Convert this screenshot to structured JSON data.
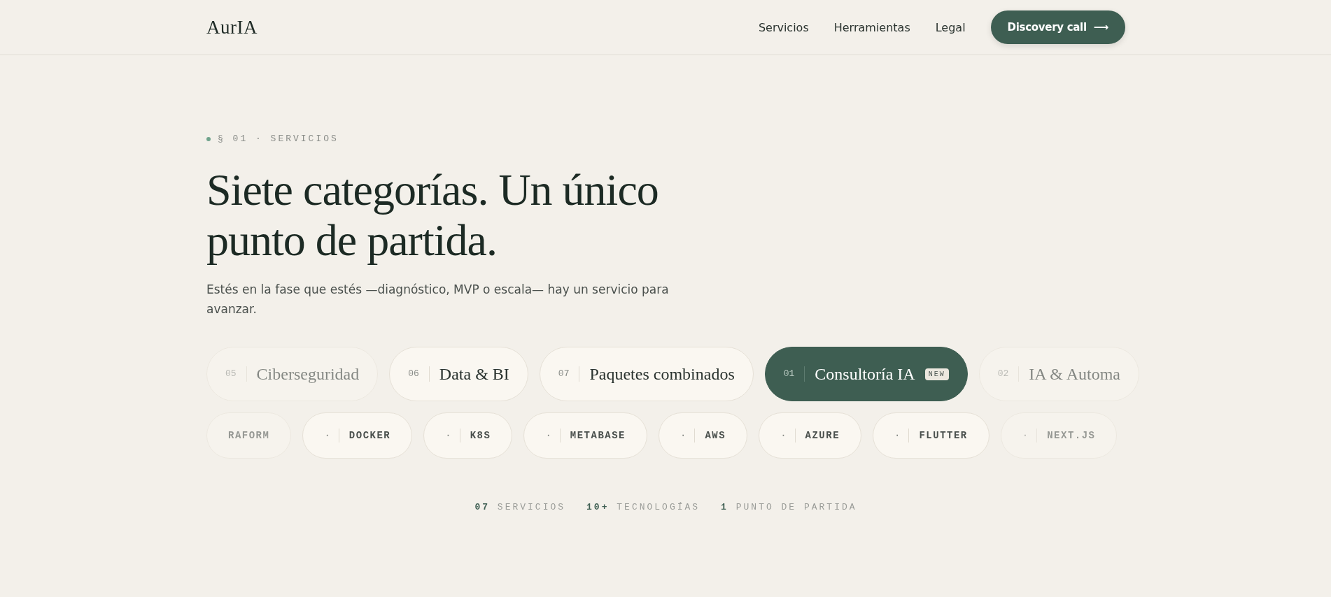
{
  "header": {
    "logo": "AurIA",
    "nav": [
      {
        "label": "Servicios"
      },
      {
        "label": "Herramientas"
      },
      {
        "label": "Legal"
      }
    ],
    "cta": {
      "label": "Discovery call",
      "arrow": "⟶"
    }
  },
  "section": {
    "eyebrow": "§ 01 · SERVICIOS",
    "title": "Siete categorías. Un único punto de partida.",
    "lead": "Estés en la fase que estés —diagnóstico, MVP o escala— hay un servicio para avanzar."
  },
  "services": [
    {
      "number": "05",
      "label": "Ciberseguridad",
      "selected": false,
      "faded": true
    },
    {
      "number": "06",
      "label": "Data & BI",
      "selected": false,
      "faded": false
    },
    {
      "number": "07",
      "label": "Paquetes combinados",
      "selected": false,
      "faded": false
    },
    {
      "number": "01",
      "label": "Consultoría IA",
      "badge": "NEW",
      "selected": true,
      "faded": false
    },
    {
      "number": "02",
      "label": "IA & Automa",
      "selected": false,
      "faded": true
    }
  ],
  "technologies": [
    {
      "label": "RAFORM",
      "faded": true
    },
    {
      "marker": "·",
      "label": "DOCKER",
      "faded": false
    },
    {
      "marker": "·",
      "label": "K8S",
      "faded": false
    },
    {
      "marker": "·",
      "label": "METABASE",
      "faded": false
    },
    {
      "marker": "·",
      "label": "AWS",
      "faded": false
    },
    {
      "marker": "·",
      "label": "AZURE",
      "faded": false
    },
    {
      "marker": "·",
      "label": "FLUTTER",
      "faded": false
    },
    {
      "marker": "·",
      "label": "NEXT.JS",
      "faded": true
    }
  ],
  "stats": [
    {
      "value": "07",
      "label": "SERVICIOS"
    },
    {
      "value": "10+",
      "label": "TECNOLOGÍAS"
    },
    {
      "value": "1",
      "label": "PUNTO DE PARTIDA"
    }
  ]
}
